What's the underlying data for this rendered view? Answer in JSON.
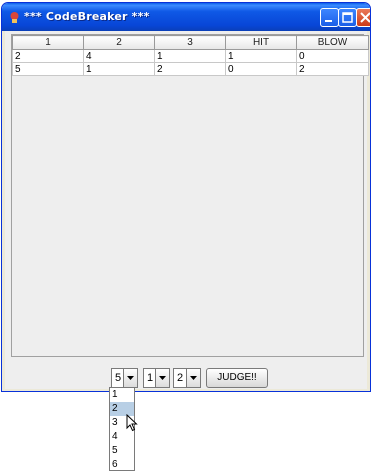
{
  "window": {
    "title": "*** CodeBreaker ***"
  },
  "table": {
    "headers": [
      "1",
      "2",
      "3",
      "HIT",
      "BLOW"
    ],
    "rows": [
      [
        "2",
        "4",
        "1",
        "1",
        "0"
      ],
      [
        "5",
        "1",
        "2",
        "0",
        "2"
      ]
    ]
  },
  "controls": {
    "digit1": "5",
    "digit2": "1",
    "digit3": "2",
    "judge_label": "JUDGE!!"
  },
  "dropdown": {
    "options": [
      "1",
      "2",
      "3",
      "4",
      "5",
      "6"
    ],
    "highlighted": "2"
  },
  "icons": {
    "app": "app-icon",
    "minimize": "minimize-icon",
    "maximize": "maximize-icon",
    "close": "close-icon",
    "dropdown_arrow": "chevron-down-icon",
    "cursor": "mouse-pointer-icon"
  },
  "colors": {
    "titlebar": "#0a52dc",
    "close_button": "#d9532f",
    "highlight": "#b8cfe5"
  }
}
